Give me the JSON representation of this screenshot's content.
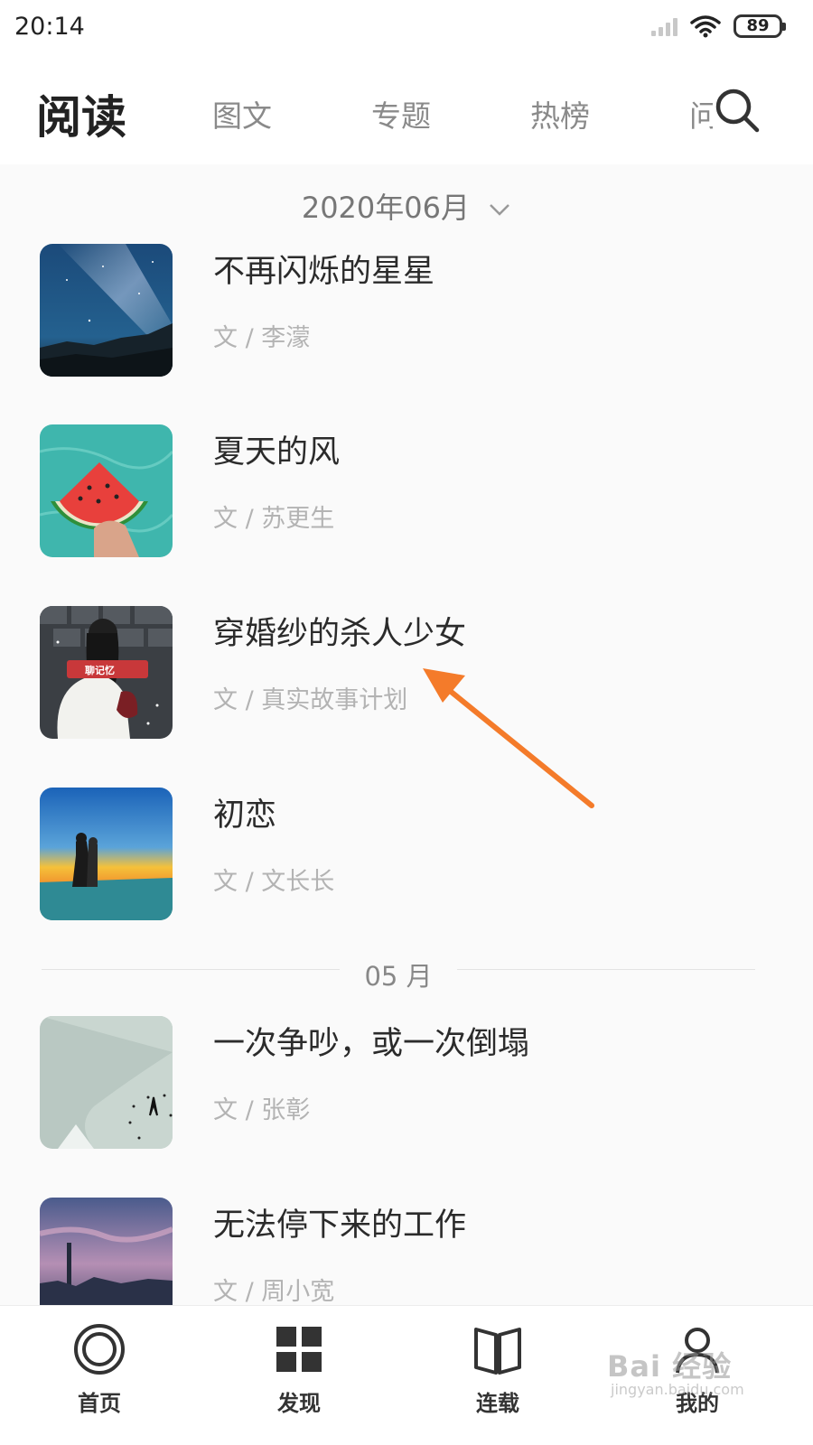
{
  "status_bar": {
    "time": "20:14",
    "battery": "89"
  },
  "header": {
    "title": "阅读",
    "tabs": [
      {
        "label": "图文"
      },
      {
        "label": "专题"
      },
      {
        "label": "热榜"
      },
      {
        "label": "问"
      }
    ]
  },
  "month_picker": {
    "label": "2020年06月"
  },
  "articles": [
    {
      "title": "不再闪烁的星星",
      "author": "文 / 李濛"
    },
    {
      "title": "夏天的风",
      "author": "文 / 苏更生"
    },
    {
      "title": "穿婚纱的杀人少女",
      "author": "文 / 真实故事计划"
    },
    {
      "title": "初恋",
      "author": "文 / 文长长"
    },
    {
      "title": "一次争吵，或一次倒塌",
      "author": "文 / 张彰"
    },
    {
      "title": "无法停下来的工作",
      "author": "文 / 周小宽"
    }
  ],
  "section_divider": {
    "label": "05 月"
  },
  "thumb_overlay_text": "聊记忆",
  "annotation": {
    "arrow_color": "#f47b2a"
  },
  "tabbar": {
    "items": [
      {
        "label": "首页",
        "icon": "home-circle-icon"
      },
      {
        "label": "发现",
        "icon": "grid-icon"
      },
      {
        "label": "连载",
        "icon": "book-icon"
      },
      {
        "label": "我的",
        "icon": "user-icon"
      }
    ]
  },
  "watermark": {
    "logo": "Bai 经验",
    "url": "jingyan.baidu.com"
  }
}
